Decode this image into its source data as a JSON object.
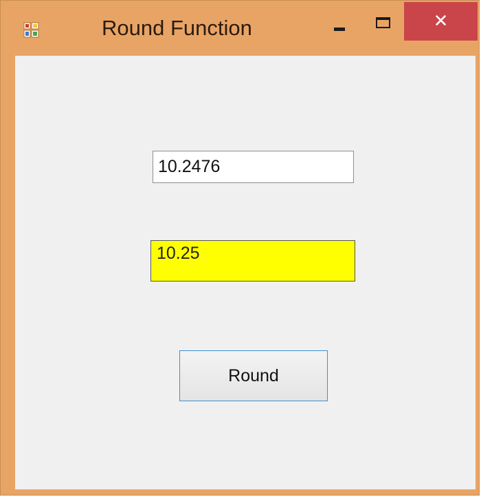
{
  "window": {
    "title": "Round Function",
    "close_glyph": "✕",
    "colors": {
      "frame": "#e8a465",
      "close": "#c9454a",
      "client": "#f0f0f0",
      "output_bg": "#ffff00",
      "button_border": "#3c8fd4"
    }
  },
  "icons": {
    "app": "app-icon",
    "minimize": "minimize-icon",
    "maximize": "maximize-icon",
    "close": "close-icon"
  },
  "form": {
    "input_value": "10.2476",
    "output_value": "10.25",
    "button_label": "Round"
  }
}
